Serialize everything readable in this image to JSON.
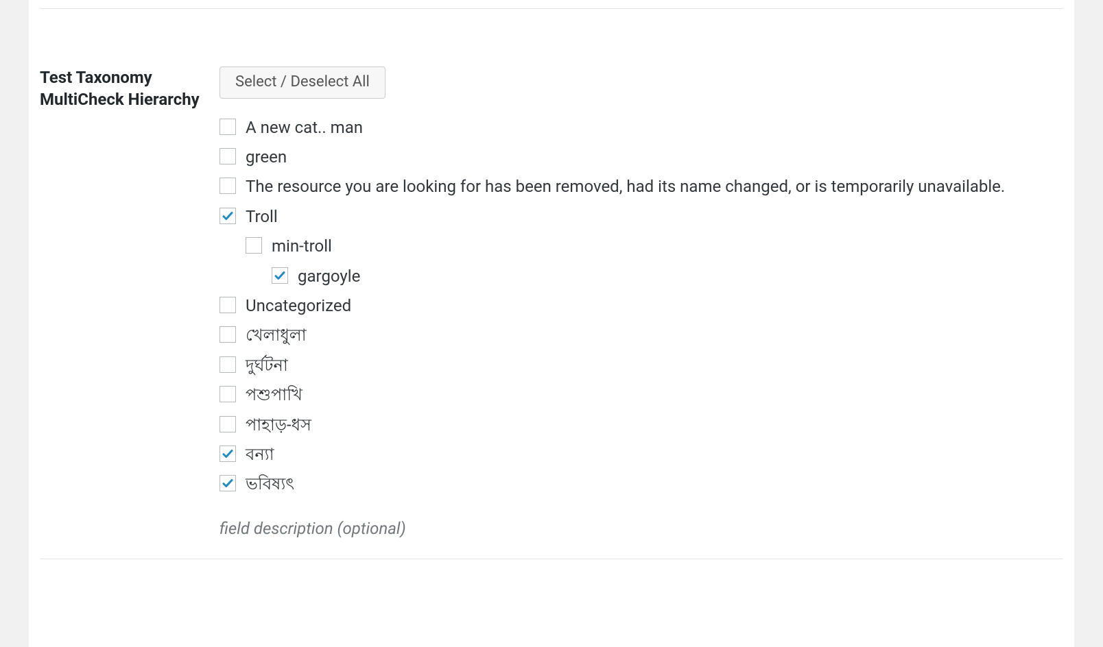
{
  "field": {
    "label": "Test Taxonomy MultiCheck Hierarchy",
    "toggle_button": "Select / Deselect All",
    "description": "field description (optional)"
  },
  "options": [
    {
      "label": "A new cat.. man",
      "checked": false,
      "indent": 0
    },
    {
      "label": "green",
      "checked": false,
      "indent": 0
    },
    {
      "label": "The resource you are looking for has been removed, had its name changed, or is temporarily unavailable.",
      "checked": false,
      "indent": 0
    },
    {
      "label": "Troll",
      "checked": true,
      "indent": 0
    },
    {
      "label": "min-troll",
      "checked": false,
      "indent": 1
    },
    {
      "label": "gargoyle",
      "checked": true,
      "indent": 2
    },
    {
      "label": "Uncategorized",
      "checked": false,
      "indent": 0
    },
    {
      "label": "খেলাধুলা",
      "checked": false,
      "indent": 0
    },
    {
      "label": "দুর্ঘটনা",
      "checked": false,
      "indent": 0
    },
    {
      "label": "পশুপাখি",
      "checked": false,
      "indent": 0
    },
    {
      "label": "পাহাড়-ধস",
      "checked": false,
      "indent": 0
    },
    {
      "label": "বন্যা",
      "checked": true,
      "indent": 0
    },
    {
      "label": "ভবিষ্যৎ",
      "checked": true,
      "indent": 0
    }
  ],
  "colors": {
    "check": "#1e8cbe"
  }
}
